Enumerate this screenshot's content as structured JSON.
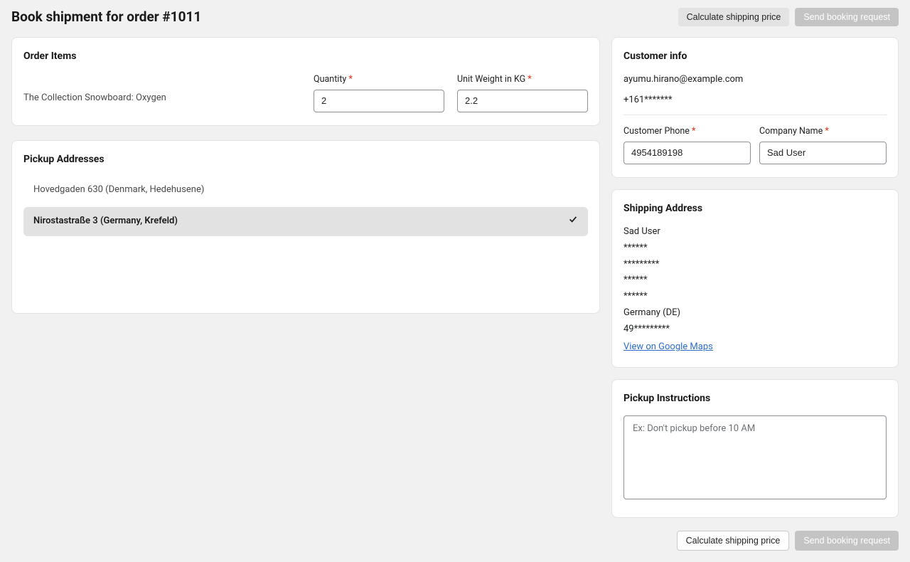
{
  "header": {
    "title": "Book shipment for order #1011",
    "calculate_label": "Calculate shipping price",
    "send_label": "Send booking request"
  },
  "order_items": {
    "title": "Order Items",
    "items": [
      {
        "name": "The Collection Snowboard: Oxygen"
      }
    ],
    "quantity_label": "Quantity",
    "quantity_value": "2",
    "weight_label": "Unit Weight in KG",
    "weight_value": "2.2"
  },
  "pickup": {
    "title": "Pickup Addresses",
    "addresses": [
      {
        "label": "Hovedgaden 630 (Denmark, Hedehusene)",
        "selected": false
      },
      {
        "label": "Nirostastraße 3 (Germany, Krefeld)",
        "selected": true
      }
    ]
  },
  "customer": {
    "title": "Customer info",
    "email": "ayumu.hirano@example.com",
    "phone_masked": "+161*******",
    "phone_label": "Customer Phone",
    "phone_value": "4954189198",
    "company_label": "Company Name",
    "company_value": "Sad User"
  },
  "shipping": {
    "title": "Shipping Address",
    "lines": [
      "Sad User",
      "******",
      "*********",
      "******",
      "******",
      "Germany (DE)",
      "49*********"
    ],
    "maps_link": "View on Google Maps"
  },
  "instructions": {
    "title": "Pickup Instructions",
    "placeholder": "Ex: Don't pickup before 10 AM",
    "value": ""
  },
  "footer": {
    "calculate_label": "Calculate shipping price",
    "send_label": "Send booking request"
  }
}
